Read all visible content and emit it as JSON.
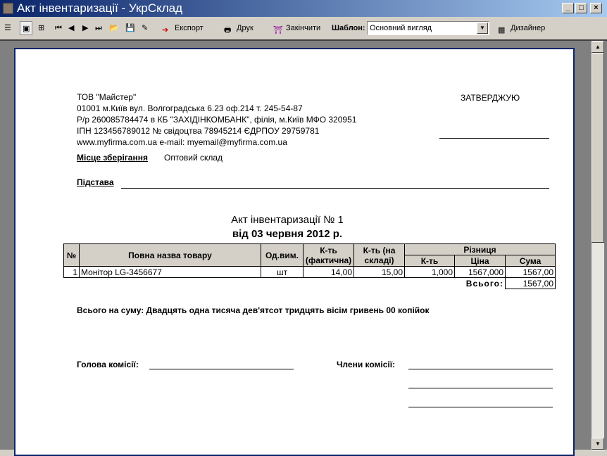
{
  "window": {
    "title": "Акт інвентаризації - УкрСклад",
    "min": "_",
    "max": "□",
    "close": "×"
  },
  "toolbar": {
    "export": "Експорт",
    "print": "Друк",
    "finish": "Закінчити",
    "template_label": "Шаблон:",
    "template_value": "Основний вигляд",
    "designer": "Дизайнер"
  },
  "doc": {
    "company": [
      "ТОВ \"Майстер\"",
      "01001 м.Київ вул. Волгоградська 6.23 оф.214 т. 245-54-87",
      "Р/р 260085784474 в КБ \"ЗАХІДІНКОМБАНК\", філія, м.Київ МФО 320951",
      "ІПН 123456789012 № свідоцтва 78945214 ЄДРПОУ 29759781",
      "www.myfirma.com.ua e-mail: myemail@myfirma.com.ua"
    ],
    "approve": "ЗАТВЕРДЖУЮ",
    "storage_label": "Місце зберігання",
    "storage_value": "Оптовий склад",
    "basis_label": "Підстава",
    "title": "Акт інвентаризації № 1",
    "date": "від 03 червня 2012 р.",
    "headers": {
      "num": "№",
      "name": "Повна назва товару",
      "unit": "Од.вим.",
      "qty_fact": "К-ть (фактична)",
      "qty_stock": "К-ть (на складі)",
      "diff": "Різниця",
      "diff_qty": "К-ть",
      "diff_price": "Ціна",
      "diff_sum": "Сума"
    },
    "rows": [
      {
        "num": "1",
        "name": "Монітор LG-3456677",
        "unit": "шт",
        "qty_fact": "14,00",
        "qty_stock": "15,00",
        "diff_qty": "1,000",
        "diff_price": "1567,000",
        "diff_sum": "1567,00"
      }
    ],
    "total_label": "Всього:",
    "total": "1567,00",
    "sum_words": "Всього на суму: Двадцять одна тисяча дев'ятсот тридцять вісім гривень 00 копійок",
    "head_label": "Голова комісії:",
    "members_label": "Члени комісії:"
  }
}
